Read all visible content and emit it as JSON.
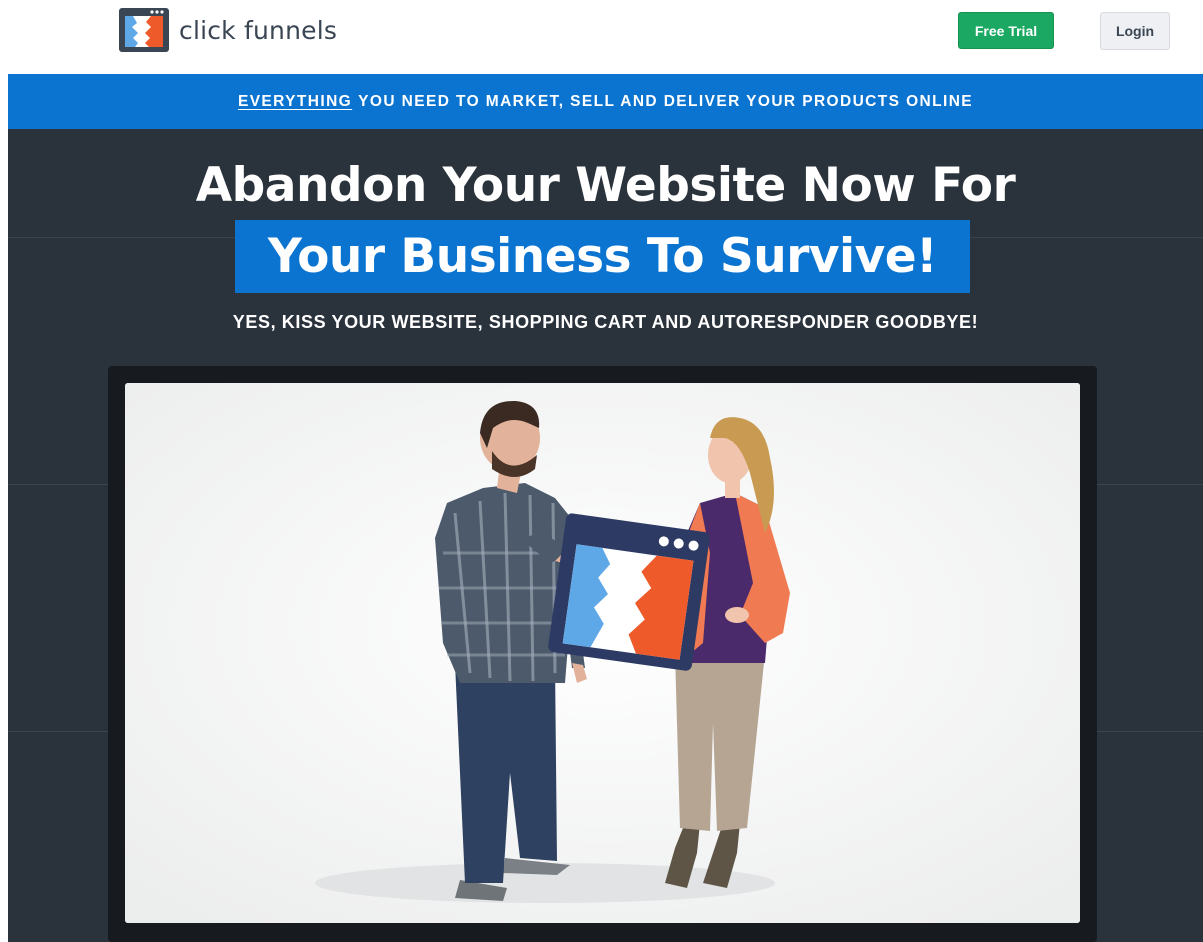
{
  "brand": {
    "name": "click funnels",
    "logo_icon": "clickfunnels-logo-icon"
  },
  "header": {
    "free_trial_label": "Free Trial",
    "login_label": "Login"
  },
  "banner": {
    "emphasis": "EVERYTHING",
    "text": "YOU NEED TO MARKET, SELL AND DELIVER YOUR PRODUCTS ONLINE"
  },
  "hero": {
    "headline_line1": "Abandon Your Website Now For",
    "headline_line2": "Your Business To Survive!",
    "subheadline": "YES, KISS YOUR WEBSITE, SHOPPING CART AND AUTORESPONDER GOODBYE!"
  },
  "video": {
    "content": "two people holding a clickfunnels logo board"
  },
  "colors": {
    "brand_blue": "#0b74d0",
    "cta_green": "#1aa862",
    "hero_bg": "#2a323c",
    "logo_dark": "#3a4654",
    "logo_orange": "#ee5a2a",
    "logo_light_blue": "#5fa8e8"
  }
}
